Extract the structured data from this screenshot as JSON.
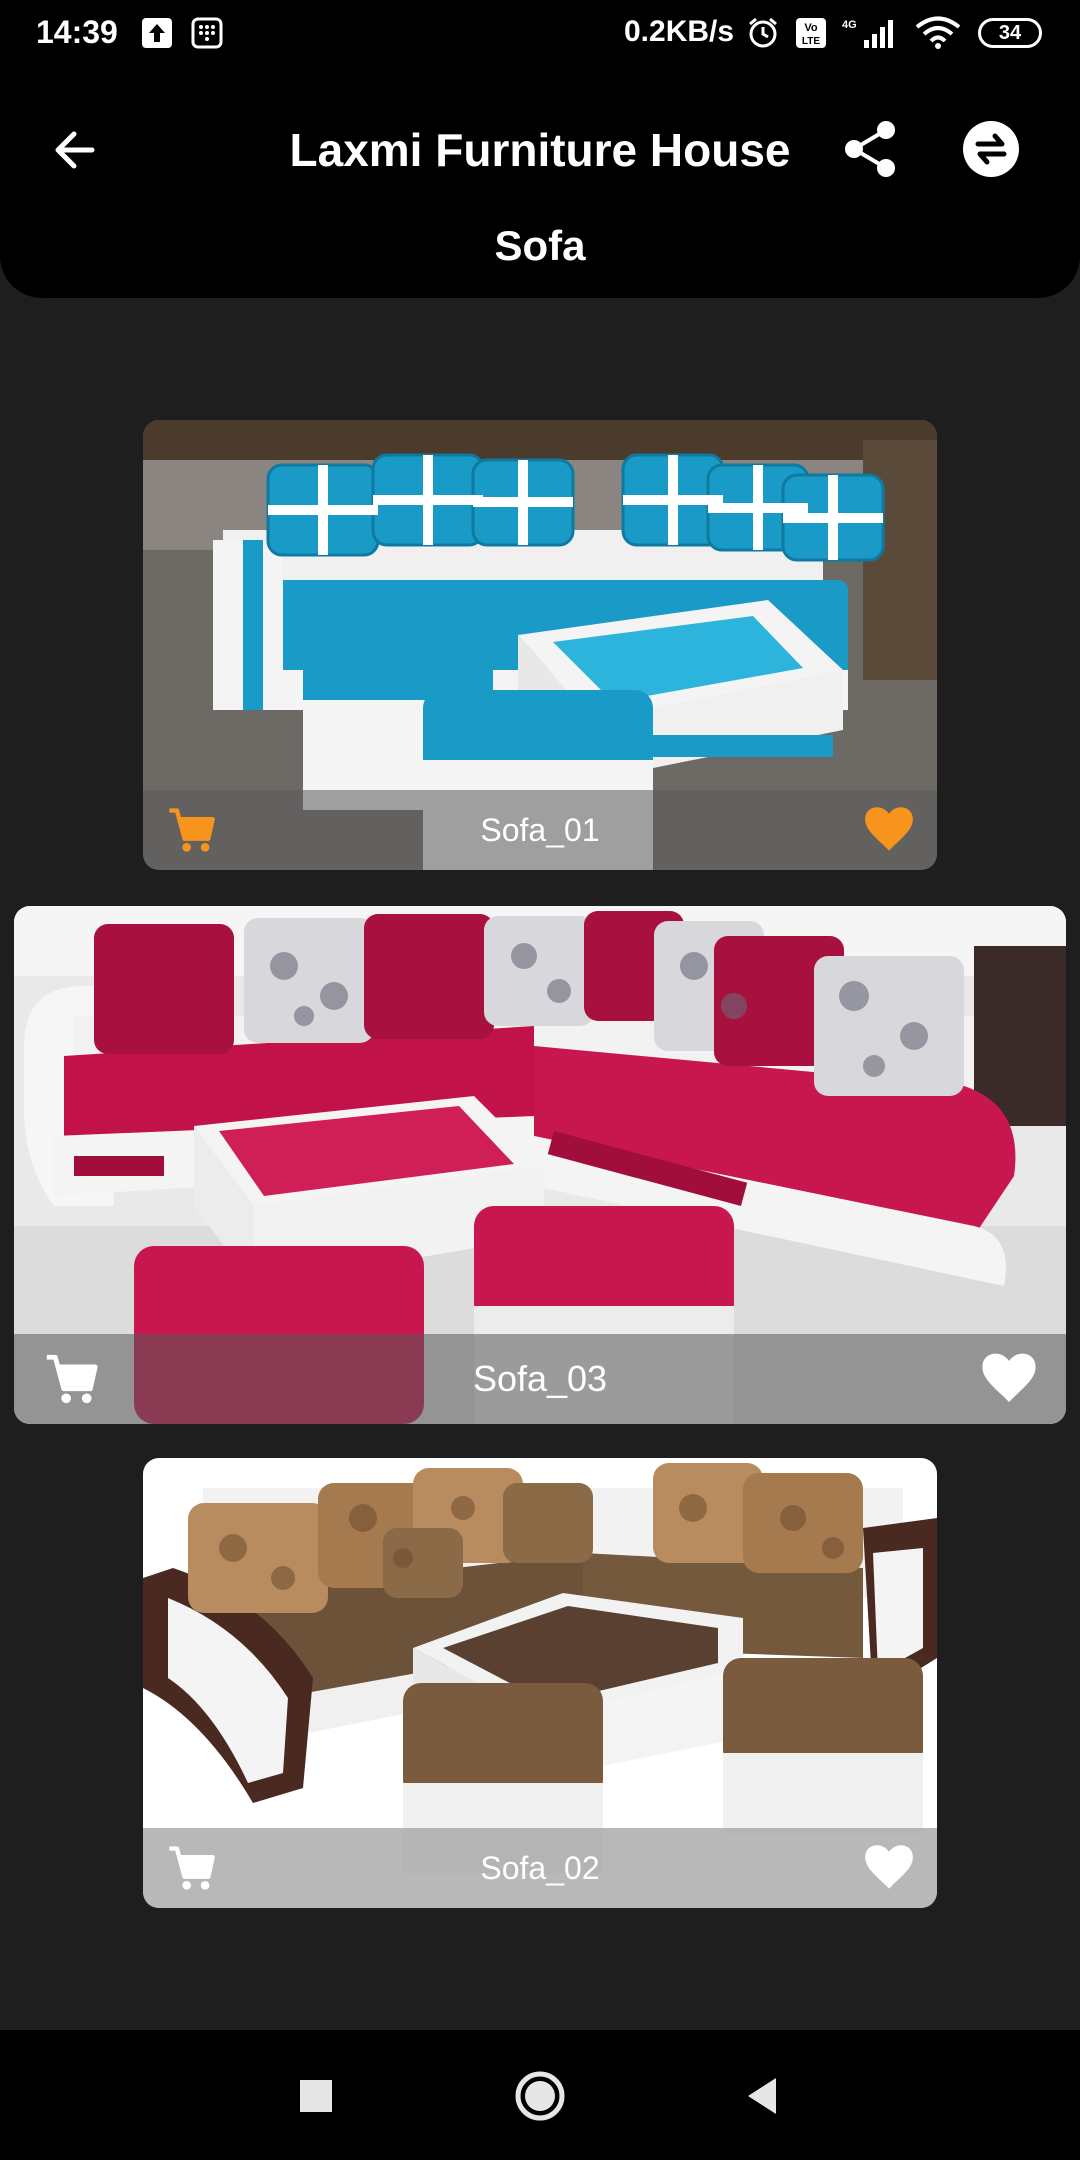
{
  "status_bar": {
    "time": "14:39",
    "network_speed": "0.2KB/s",
    "battery": "34",
    "icons": [
      "upload-icon",
      "keypad-icon",
      "alarm-icon",
      "volte-icon",
      "signal-icon",
      "wifi-icon",
      "battery-icon"
    ]
  },
  "app_bar": {
    "title": "Laxmi Furniture House",
    "category": "Sofa",
    "icons": [
      "back-arrow-icon",
      "share-icon",
      "swap-icon"
    ]
  },
  "products": [
    {
      "name": "Sofa_01",
      "favorite": true,
      "accent_color": "#f7941d",
      "sofa_color": "#1a9bc7"
    },
    {
      "name": "Sofa_03",
      "favorite": false,
      "accent_color": "#ffffff",
      "sofa_color": "#c2124a"
    },
    {
      "name": "Sofa_02",
      "favorite": false,
      "accent_color": "#ffffff",
      "sofa_color": "#6b5238"
    }
  ],
  "nav_bar": {
    "icons": [
      "recents-square-icon",
      "home-circle-icon",
      "back-triangle-icon"
    ]
  },
  "colors": {
    "background": "#1e1e1e",
    "app_bar": "#000000",
    "favorite_active": "#f7941d"
  }
}
